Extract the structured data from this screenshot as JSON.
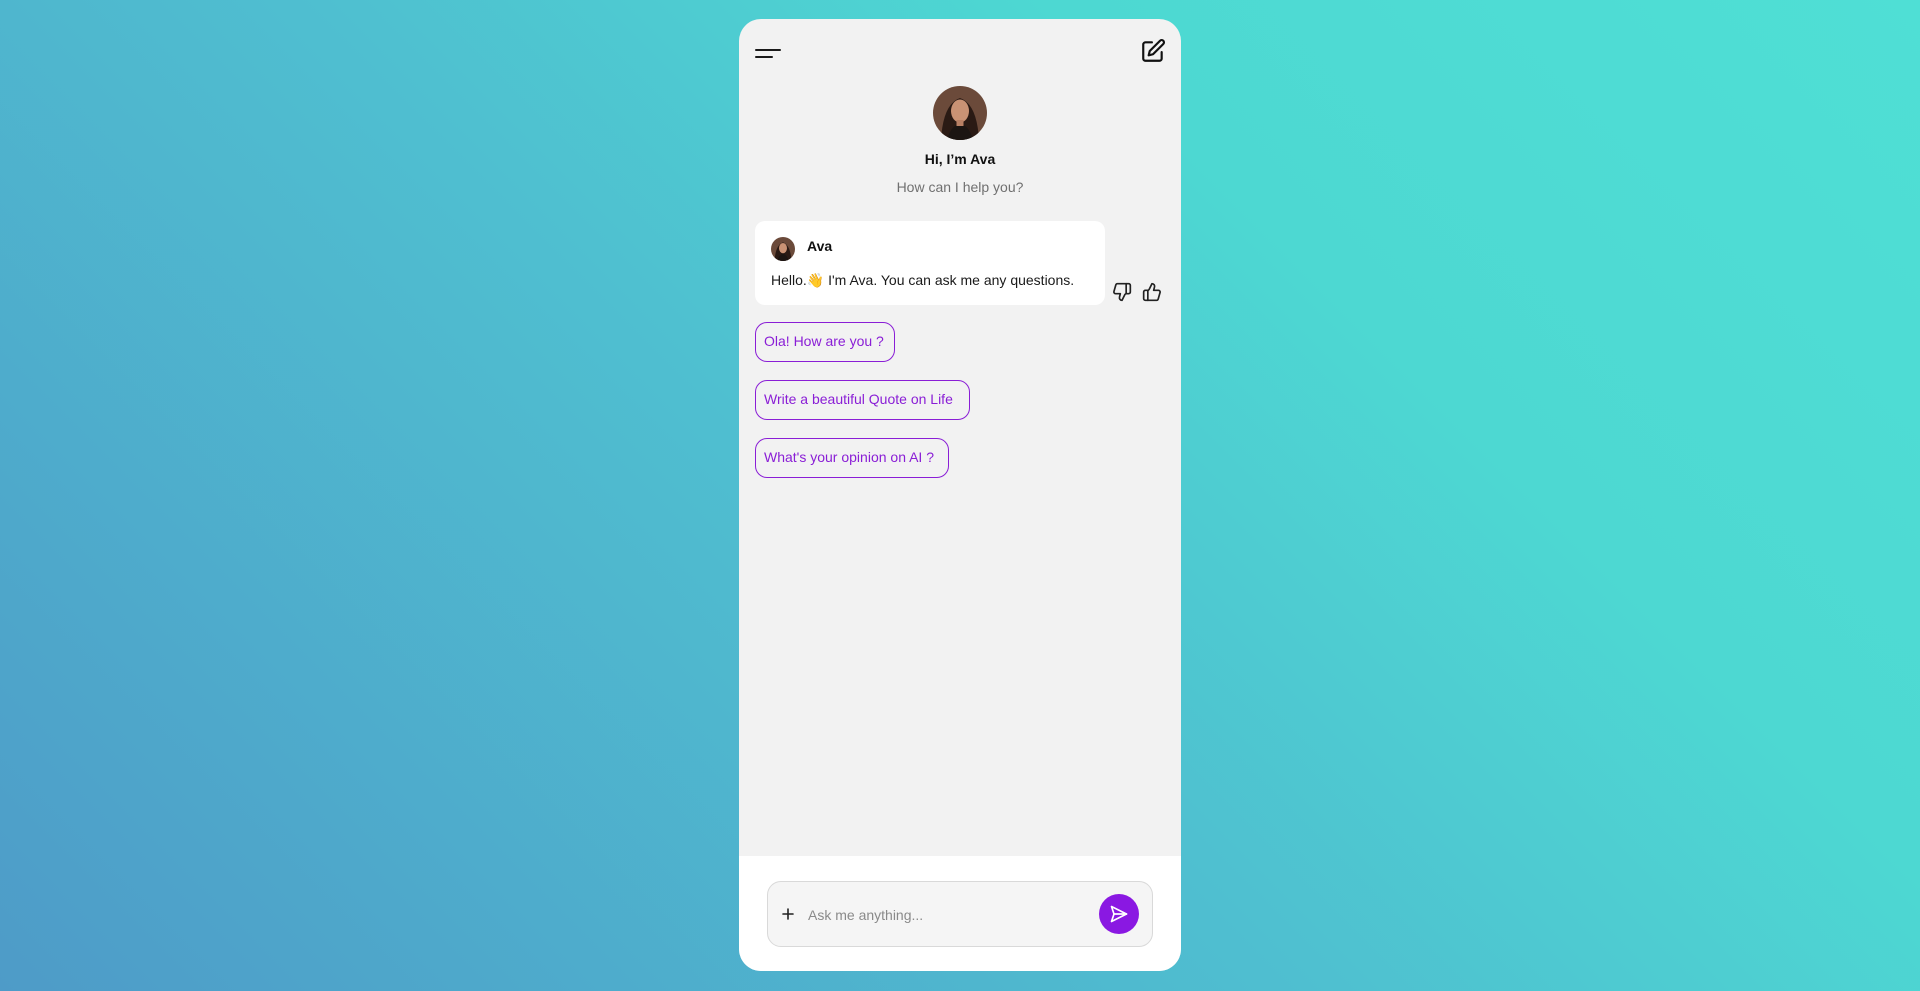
{
  "colors": {
    "accent": "#8a1ed6",
    "send_button": "#8a18e2",
    "panel_background": "#f2f2f2",
    "bubble_background": "#ffffff"
  },
  "header": {
    "menu_icon": "hamburger-menu-icon",
    "compose_icon": "edit-square-icon"
  },
  "hero": {
    "title": "Hi, I’m Ava",
    "subtitle": "How can I help you?"
  },
  "message": {
    "sender": "Ava",
    "text_before": "Hello.",
    "emoji": "👋",
    "text_after": " I'm Ava. You can ask me any questions.",
    "feedback_icons": [
      "thumbs-down-icon",
      "thumbs-up-icon"
    ]
  },
  "suggestions": [
    {
      "label": "Ola! How are you ?"
    },
    {
      "label": "Write a beautiful Quote on Life"
    },
    {
      "label": "What's your opinion on AI ?"
    }
  ],
  "composer": {
    "placeholder": "Ask me anything...",
    "value": "",
    "add_icon": "plus-icon",
    "send_icon": "send-icon"
  }
}
